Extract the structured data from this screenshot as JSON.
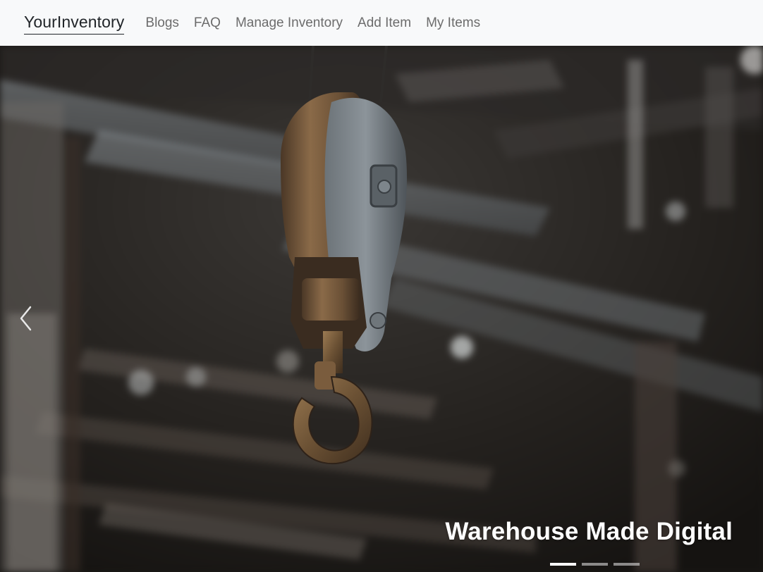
{
  "navbar": {
    "brand": "YourInventory",
    "links": [
      {
        "label": "Blogs"
      },
      {
        "label": "FAQ"
      },
      {
        "label": "Manage Inventory"
      },
      {
        "label": "Add Item"
      },
      {
        "label": "My Items"
      }
    ]
  },
  "carousel": {
    "caption": "Warehouse Made Digital",
    "prev_icon": "chevron-left-icon",
    "active_slide": 1,
    "slide_count": 3
  },
  "colors": {
    "navbar_bg": "#f8f9fa",
    "brand_text": "#212529",
    "nav_link_text": "#6c6c6c",
    "caption_text": "#ffffff"
  }
}
